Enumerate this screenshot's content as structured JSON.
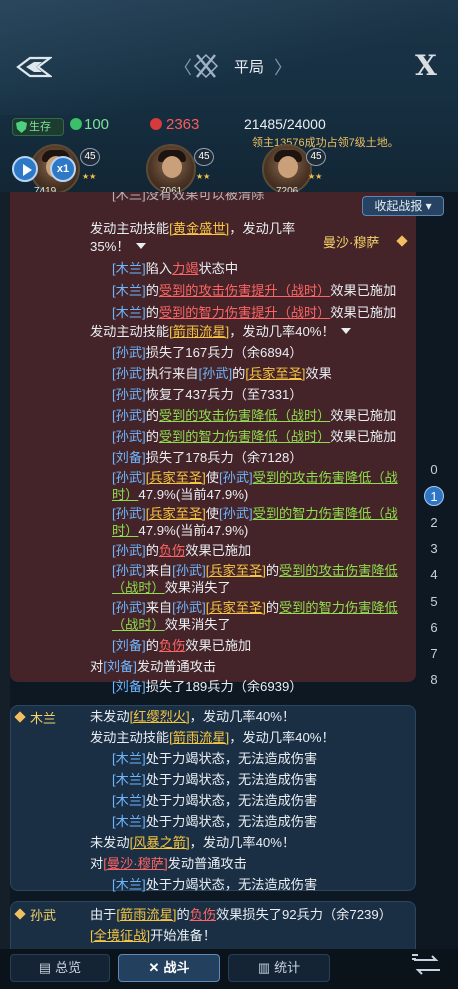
{
  "header": {
    "mode_label": "平局",
    "close_label": "X",
    "status_pill": "生存",
    "ally_health": "100",
    "enemy_health": "2363",
    "troops": "21485/24000",
    "lord_note": "领主13576成功占领7级土地。",
    "speed_label": "x1",
    "generals": [
      {
        "level": "45",
        "troops": "7419"
      },
      {
        "level": "45",
        "troops": "7061"
      },
      {
        "level": "45",
        "troops": "7206"
      }
    ]
  },
  "log": {
    "collapse_label": "收起战报",
    "top_cut_line": "[木兰]没有效果可以被清除",
    "enemy_actor": "曼沙·穆萨",
    "enemy_lines": [
      {
        "parts": [
          [
            "发动主动技能",
            ""
          ],
          [
            "[黄金盛世]",
            "g"
          ],
          [
            "，发动几率",
            ""
          ]
        ]
      },
      {
        "parts": [
          [
            "35%！",
            ""
          ]
        ]
      },
      {
        "parts": [
          [
            "[木兰]",
            "b"
          ],
          [
            "陷入",
            ""
          ],
          [
            "力竭",
            "r"
          ],
          [
            "状态中",
            ""
          ]
        ]
      },
      {
        "parts": [
          [
            "[木兰]",
            "b"
          ],
          [
            "的",
            ""
          ],
          [
            "受到的攻击伤害提升（战时）",
            "r"
          ],
          [
            "效果已施加",
            ""
          ]
        ]
      },
      {
        "parts": [
          [
            "[木兰]",
            "b"
          ],
          [
            "的",
            ""
          ],
          [
            "受到的智力伤害提升（战时）",
            "r"
          ],
          [
            "效果已施加",
            ""
          ]
        ]
      },
      {
        "parts": [
          [
            "发动主动技能",
            ""
          ],
          [
            "[箭雨流星]",
            "g"
          ],
          [
            "，发动几率40%！",
            ""
          ]
        ]
      },
      {
        "parts": [
          [
            "[孙武]",
            "b"
          ],
          [
            "损失了167兵力（余6894）",
            ""
          ]
        ]
      },
      {
        "parts": [
          [
            "[孙武]",
            "b"
          ],
          [
            "执行来自",
            ""
          ],
          [
            "[孙武]",
            "b"
          ],
          [
            "的",
            ""
          ],
          [
            "[兵家至圣]",
            "g"
          ],
          [
            "效果",
            ""
          ]
        ]
      },
      {
        "parts": [
          [
            "[孙武]",
            "b"
          ],
          [
            "恢复了437兵力（至7331）",
            ""
          ]
        ]
      },
      {
        "parts": [
          [
            "[孙武]",
            "b"
          ],
          [
            "的",
            ""
          ],
          [
            "受到的攻击伤害降低（战时）",
            "gr"
          ],
          [
            "效果已施加",
            ""
          ]
        ]
      },
      {
        "parts": [
          [
            "[孙武]",
            "b"
          ],
          [
            "的",
            ""
          ],
          [
            "受到的智力伤害降低（战时）",
            "gr"
          ],
          [
            "效果已施加",
            ""
          ]
        ]
      },
      {
        "parts": [
          [
            "[刘备]",
            "b"
          ],
          [
            "损失了178兵力（余7128）",
            ""
          ]
        ]
      },
      {
        "parts": [
          [
            "[孙武]",
            "b"
          ],
          [
            "[兵家至圣]",
            "g"
          ],
          [
            "使",
            ""
          ],
          [
            "[孙武]",
            "b"
          ],
          [
            "受到的攻击伤害降低（战",
            "gr"
          ]
        ]
      },
      {
        "parts": [
          [
            "时）",
            "gr"
          ],
          [
            "47.9%(当前47.9%)",
            ""
          ]
        ]
      },
      {
        "parts": [
          [
            "[孙武]",
            "b"
          ],
          [
            "[兵家至圣]",
            "g"
          ],
          [
            "使",
            ""
          ],
          [
            "[孙武]",
            "b"
          ],
          [
            "受到的智力伤害降低（战",
            "gr"
          ]
        ]
      },
      {
        "parts": [
          [
            "时）",
            "gr"
          ],
          [
            "47.9%(当前47.9%)",
            ""
          ]
        ]
      },
      {
        "parts": [
          [
            "[孙武]",
            "b"
          ],
          [
            "的",
            ""
          ],
          [
            "负伤",
            "r"
          ],
          [
            "效果已施加",
            ""
          ]
        ]
      },
      {
        "parts": [
          [
            "[孙武]",
            "b"
          ],
          [
            "来自",
            ""
          ],
          [
            "[孙武]",
            "b"
          ],
          [
            "[兵家至圣]",
            "g"
          ],
          [
            "的",
            ""
          ],
          [
            "受到的攻击伤害降低",
            "gr"
          ]
        ]
      },
      {
        "parts": [
          [
            "（战时）",
            "gr"
          ],
          [
            "效果消失了",
            ""
          ]
        ]
      },
      {
        "parts": [
          [
            "[孙武]",
            "b"
          ],
          [
            "来自",
            ""
          ],
          [
            "[孙武]",
            "b"
          ],
          [
            "[兵家至圣]",
            "g"
          ],
          [
            "的",
            ""
          ],
          [
            "受到的智力伤害降低",
            "gr"
          ]
        ]
      },
      {
        "parts": [
          [
            "（战时）",
            "gr"
          ],
          [
            "效果消失了",
            ""
          ]
        ]
      },
      {
        "parts": [
          [
            "[刘备]",
            "b"
          ],
          [
            "的",
            ""
          ],
          [
            "负伤",
            "r"
          ],
          [
            "效果已施加",
            ""
          ]
        ]
      },
      {
        "parts": [
          [
            "对",
            ""
          ],
          [
            "[刘备]",
            "b"
          ],
          [
            "发动普通攻击",
            ""
          ]
        ]
      },
      {
        "parts": [
          [
            "[刘备]",
            "b"
          ],
          [
            "损失了189兵力（余6939）",
            ""
          ]
        ]
      }
    ],
    "mulan_actor": "木兰",
    "mulan_lines": [
      {
        "parts": [
          [
            "未发动",
            ""
          ],
          [
            "[红缨烈火]",
            "g"
          ],
          [
            "，发动几率40%！",
            ""
          ]
        ]
      },
      {
        "parts": [
          [
            "发动主动技能",
            ""
          ],
          [
            "[箭雨流星]",
            "g"
          ],
          [
            "，发动几率40%！",
            ""
          ]
        ]
      },
      {
        "parts": [
          [
            "[木兰]",
            "b"
          ],
          [
            "处于力竭状态，无法造成伤害",
            ""
          ]
        ]
      },
      {
        "parts": [
          [
            "[木兰]",
            "b"
          ],
          [
            "处于力竭状态，无法造成伤害",
            ""
          ]
        ]
      },
      {
        "parts": [
          [
            "[木兰]",
            "b"
          ],
          [
            "处于力竭状态，无法造成伤害",
            ""
          ]
        ]
      },
      {
        "parts": [
          [
            "[木兰]",
            "b"
          ],
          [
            "处于力竭状态，无法造成伤害",
            ""
          ]
        ]
      },
      {
        "parts": [
          [
            "未发动",
            ""
          ],
          [
            "[风暴之箭]",
            "g"
          ],
          [
            "，发动几率40%！",
            ""
          ]
        ]
      },
      {
        "parts": [
          [
            "对",
            ""
          ],
          [
            "[曼沙·穆萨]",
            "r"
          ],
          [
            "发动普通攻击",
            ""
          ]
        ]
      },
      {
        "parts": [
          [
            "[木兰]",
            "b"
          ],
          [
            "处于力竭状态，无法造成伤害",
            ""
          ]
        ]
      }
    ],
    "sunwu_actor": "孙武",
    "sunwu_lines": [
      {
        "parts": [
          [
            "由于",
            ""
          ],
          [
            "[箭雨流星]",
            "g"
          ],
          [
            "的",
            ""
          ],
          [
            "负伤",
            "r"
          ],
          [
            "效果损失了92兵力（余7239）",
            ""
          ]
        ]
      },
      {
        "parts": [
          [
            "[全境征战]",
            "g"
          ],
          [
            "开始准备！",
            ""
          ]
        ]
      }
    ],
    "page_numbers": [
      "0",
      "1",
      "2",
      "3",
      "4",
      "5",
      "6",
      "7",
      "8"
    ],
    "active_page": "1"
  },
  "footer": {
    "tabs": [
      "总览",
      "战斗",
      "统计"
    ],
    "active_tab": "战斗"
  }
}
